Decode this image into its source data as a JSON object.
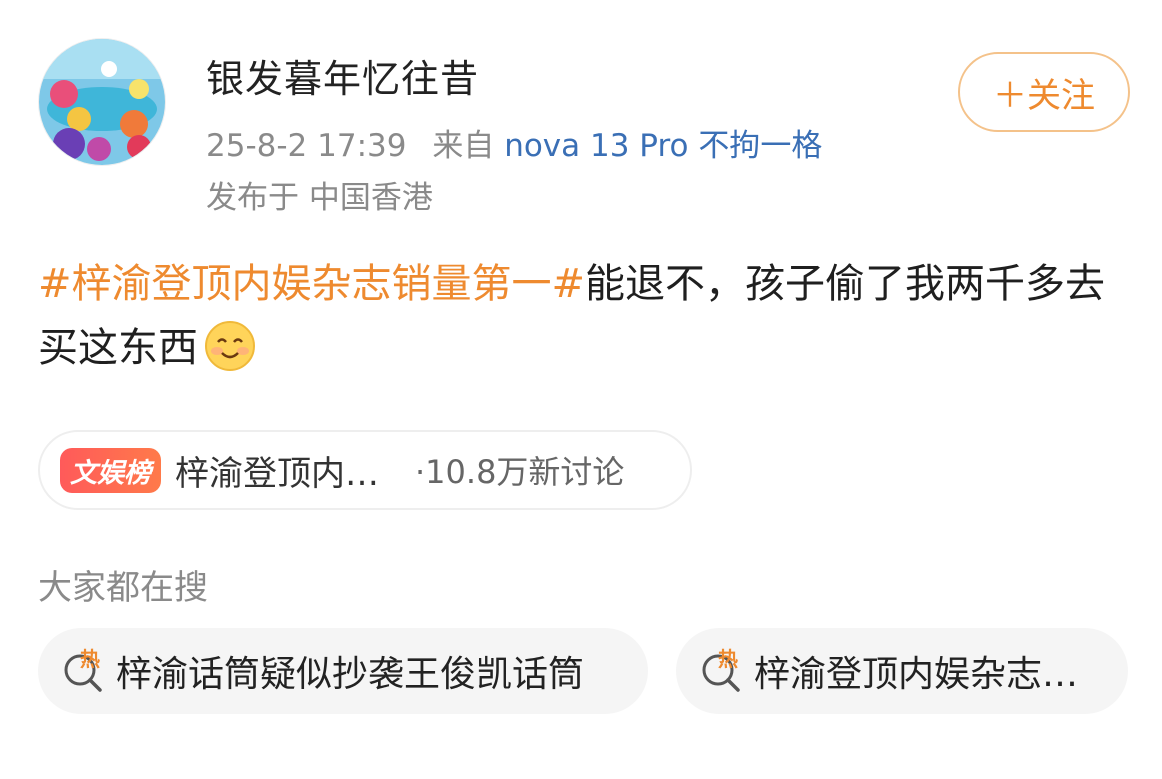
{
  "post": {
    "author": "银发暮年忆往昔",
    "time": "25-8-2 17:39",
    "from_label": "来自",
    "device": "nova 13 Pro 不拘一格",
    "location": "发布于 中国香港",
    "follow_label": "＋关注",
    "topic": "#梓渝登顶内娱杂志销量第一#",
    "text": "能退不，孩子偷了我两千多去买这东西",
    "emoji_icon": "smile-emoji"
  },
  "tag": {
    "badge": "文娱榜",
    "title": "梓渝登顶内…",
    "count": "·10.8万新讨论"
  },
  "search": {
    "heading": "大家都在搜",
    "hot_icon_label": "热",
    "items": [
      {
        "text": "梓渝话筒疑似抄袭王俊凯话筒"
      },
      {
        "text": "梓渝登顶内娱杂志…"
      }
    ]
  },
  "colors": {
    "accent": "#ee8a2f",
    "device_link": "#3a6fb5",
    "meta_gray": "#8a8a8a"
  }
}
